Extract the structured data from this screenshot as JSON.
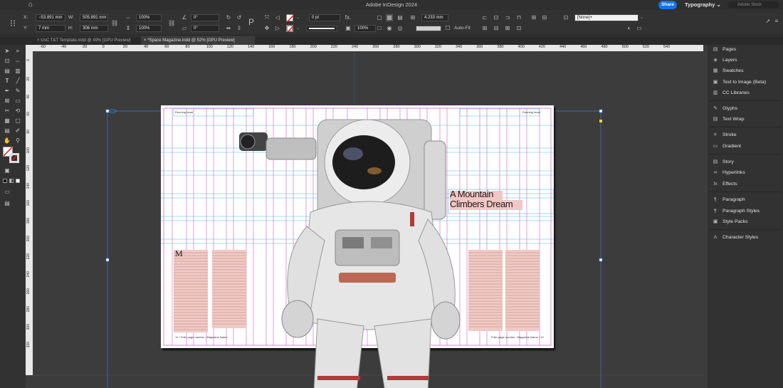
{
  "app": {
    "title": "Adobe InDesign 2024",
    "share_label": "Share",
    "workspace": "Typography",
    "stock_placeholder": "Adobe Stock"
  },
  "control": {
    "x_label": "X:",
    "x_value": "−53.891 mm",
    "y_label": "Y:",
    "y_value": "7 mm",
    "w_label": "W:",
    "w_value": "505.891 mm",
    "h_label": "H:",
    "h_value": "306 mm",
    "scale_x": "100%",
    "scale_y": "100%",
    "rotate": "0°",
    "shear": "0°",
    "stroke_weight": "0 pt",
    "opacity": "100%",
    "gap": "4.233 mm",
    "autofit_label": "Auto-Fit",
    "object_style": "[None]+",
    "fx_label": "fx."
  },
  "tabs": [
    {
      "label": "UoC T&T Template.indd @ 49% [GPU Preview]"
    },
    {
      "label": "*Space Magazine.indd @ 52% [GPU Preview]"
    }
  ],
  "ruler": {
    "h_ticks": [
      "-60",
      "-40",
      "-20",
      "0",
      "20",
      "40",
      "60",
      "80",
      "100",
      "120",
      "140",
      "160",
      "180",
      "200",
      "220",
      "240",
      "260",
      "280",
      "300",
      "320",
      "340",
      "360",
      "380",
      "400",
      "420",
      "440",
      "460",
      "480",
      "500",
      "520",
      "540"
    ],
    "v_ticks": [
      "0",
      "20",
      "40",
      "60",
      "80",
      "100",
      "120",
      "140",
      "160",
      "180",
      "200",
      "220",
      "240",
      "260",
      "280",
      "300",
      "320"
    ]
  },
  "document": {
    "running_head_left": "Running head",
    "running_head_right": "Running head",
    "headline_line1": "A Mountain",
    "headline_line2": "Climbers Dream",
    "footer_left": "12 / Folio page number / Magazine Name",
    "footer_right": "Folio page number / Magazine Name / 13"
  },
  "panels": [
    {
      "label": "Pages",
      "icon": "pages-icon"
    },
    {
      "label": "Layers",
      "icon": "layers-icon"
    },
    {
      "label": "Swatches",
      "icon": "swatches-icon"
    },
    {
      "label": "Text to Image (Beta)",
      "icon": "text-to-image-icon"
    },
    {
      "label": "CC Libraries",
      "icon": "cc-libraries-icon"
    },
    {
      "label": "Glyphs",
      "icon": "glyphs-icon"
    },
    {
      "label": "Text Wrap",
      "icon": "text-wrap-icon"
    },
    {
      "label": "Stroke",
      "icon": "stroke-icon"
    },
    {
      "label": "Gradient",
      "icon": "gradient-icon"
    },
    {
      "label": "Story",
      "icon": "story-icon"
    },
    {
      "label": "Hyperlinks",
      "icon": "hyperlinks-icon"
    },
    {
      "label": "Effects",
      "icon": "effects-icon"
    },
    {
      "label": "Paragraph",
      "icon": "paragraph-icon"
    },
    {
      "label": "Paragraph Styles",
      "icon": "paragraph-styles-icon"
    },
    {
      "label": "Style Packs",
      "icon": "style-packs-icon"
    },
    {
      "label": "Character Styles",
      "icon": "character-styles-icon"
    }
  ],
  "colors": {
    "accent": "#1473e6",
    "guide_magenta": "#c23cc2",
    "guide_cyan": "#4fb8e6",
    "frame_blue": "#3a7bd5",
    "highlight": "#f3c6c6"
  }
}
